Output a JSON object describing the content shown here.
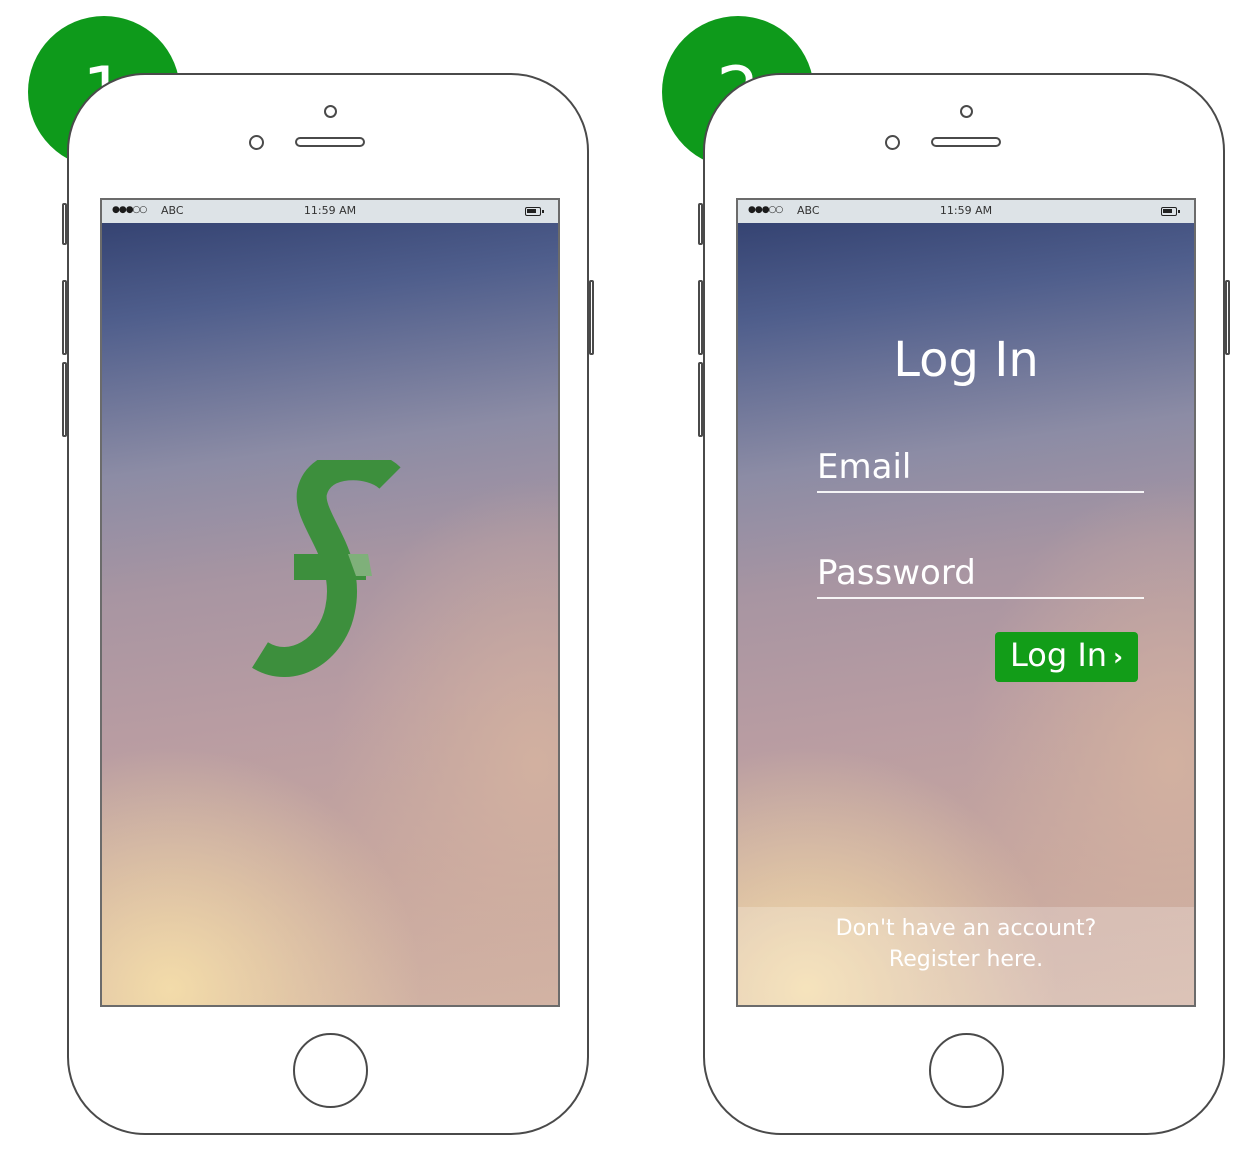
{
  "badges": {
    "step_one": "1",
    "step_two": "2"
  },
  "status_bar": {
    "signal": "●●●○○",
    "carrier": "ABC",
    "time": "11:59 AM"
  },
  "splash": {
    "logo_icon": "stylized-f-currency-logo",
    "logo_color": "#3d8f3d"
  },
  "login": {
    "title": "Log In",
    "email_placeholder": "Email",
    "password_placeholder": "Password",
    "button_label": "Log In",
    "button_chevron": "›",
    "button_color": "#129d18",
    "register_line1": "Don't have an account?",
    "register_line2": "Register here."
  },
  "colors": {
    "badge_green": "#0e9a1b",
    "gradient_top": "#2f3d6c",
    "gradient_bottom": "#d2b3a4"
  }
}
